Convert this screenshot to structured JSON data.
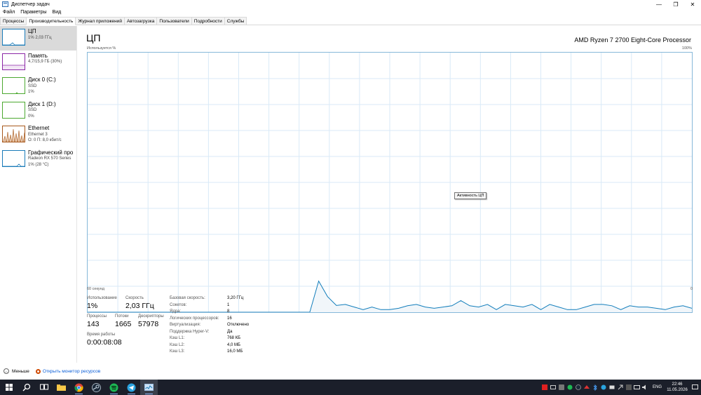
{
  "window": {
    "title": "Диспетчер задач",
    "controls": {
      "minimize": "—",
      "restore": "❐",
      "close": "✕"
    }
  },
  "menu": [
    "Файл",
    "Параметры",
    "Вид"
  ],
  "tabs": [
    {
      "label": "Процессы",
      "active": false
    },
    {
      "label": "Производительность",
      "active": true
    },
    {
      "label": "Журнал приложений",
      "active": false
    },
    {
      "label": "Автозагрузка",
      "active": false
    },
    {
      "label": "Пользователи",
      "active": false
    },
    {
      "label": "Подробности",
      "active": false
    },
    {
      "label": "Службы",
      "active": false
    }
  ],
  "sidebar": {
    "items": [
      {
        "name": "ЦП",
        "line1": "1% 2,03 ГГц",
        "line2": "",
        "color": "#1a7bb9",
        "active": true
      },
      {
        "name": "Память",
        "line1": "4,7/15,9 ГБ (30%)",
        "line2": "",
        "color": "#8b26a6",
        "active": false
      },
      {
        "name": "Диск 0 (C:)",
        "line1": "SSD",
        "line2": "1%",
        "color": "#4ca930",
        "active": false
      },
      {
        "name": "Диск 1 (D:)",
        "line1": "SSD",
        "line2": "0%",
        "color": "#4ca930",
        "active": false
      },
      {
        "name": "Ethernet",
        "line1": "Ethernet 3",
        "line2": "О: 0 П: 8,0 кбит/с",
        "color": "#a7581c",
        "active": false
      },
      {
        "name": "Графический про",
        "line1": "Radeon RX 570 Series",
        "line2": "1% (28 °C)",
        "color": "#1a7bb9",
        "active": false
      }
    ]
  },
  "main": {
    "title": "ЦП",
    "cpu_model": "AMD Ryzen 7 2700 Eight-Core Processor",
    "usage_label": "Используется %",
    "max_label": "100%",
    "axis_left": "60 секунд",
    "axis_right": "0",
    "tooltip": "Активность ЦП",
    "graph_color": "#117dbb",
    "graph_series": [
      0,
      0,
      0,
      0,
      0,
      0,
      0,
      0,
      0,
      0,
      0,
      0,
      0,
      0,
      0,
      0,
      0,
      0,
      0,
      0,
      0,
      0,
      0,
      0,
      0,
      0,
      0,
      0,
      0,
      0,
      0,
      0,
      0,
      0,
      0,
      0,
      0,
      0,
      0,
      0,
      0,
      0,
      0,
      0,
      0,
      0,
      0,
      0,
      0,
      0,
      0,
      0,
      0,
      0,
      0,
      0,
      0,
      0,
      0,
      0,
      0,
      0,
      0,
      0,
      0,
      0,
      0,
      0,
      0,
      0,
      0,
      0,
      0,
      0,
      0,
      0,
      0,
      0,
      0,
      0,
      0,
      0,
      0,
      0,
      0,
      0,
      0,
      0,
      0,
      0,
      0,
      0,
      0,
      0,
      0,
      0,
      0,
      0,
      0,
      0,
      0,
      0,
      0,
      0,
      0,
      0,
      0,
      0,
      0,
      0,
      0,
      0,
      0,
      0,
      0,
      0,
      0,
      0,
      0,
      0,
      0,
      0,
      0,
      0,
      0,
      0,
      0,
      0,
      0,
      0,
      0,
      0,
      0,
      0,
      0,
      0,
      0,
      0,
      0,
      0,
      0,
      0,
      0,
      0,
      0,
      0,
      0,
      0,
      0,
      0,
      0,
      0,
      0,
      0,
      0,
      0,
      0,
      0,
      0,
      0,
      0,
      0,
      0,
      0,
      0,
      0,
      0,
      0,
      0,
      0,
      0,
      0,
      0,
      0,
      0,
      0,
      0,
      0,
      0,
      0,
      0,
      0,
      0,
      0,
      0,
      0,
      0,
      0,
      0,
      0,
      0,
      0,
      0,
      0,
      0,
      0,
      0,
      0,
      0,
      0,
      0,
      0,
      0,
      0,
      0,
      0,
      0,
      0,
      0,
      0,
      0,
      0,
      0,
      0,
      0,
      0,
      0,
      0,
      0,
      0,
      0,
      0,
      0,
      0,
      0,
      0,
      0,
      0,
      0,
      0,
      0,
      0,
      0,
      0,
      0,
      0,
      0,
      0,
      0,
      0,
      0,
      0,
      0,
      0,
      0,
      0,
      0,
      0,
      0,
      0,
      0,
      0,
      0,
      0,
      0,
      0,
      0,
      0,
      0,
      0,
      0,
      0,
      0,
      0,
      0,
      0,
      0,
      0,
      0,
      0,
      0,
      0,
      0,
      0,
      0,
      0,
      0,
      0,
      0,
      0,
      0,
      0,
      0,
      0,
      0,
      0,
      0,
      0,
      0,
      0,
      0,
      0,
      0,
      0,
      0,
      0,
      0,
      0,
      0,
      0,
      0,
      0,
      0,
      0,
      0
    ],
    "cpu_history": [
      0,
      0,
      0,
      0,
      0,
      0,
      0,
      0,
      0,
      0,
      0,
      0,
      0,
      0,
      0,
      0,
      0,
      0,
      0,
      0,
      0,
      0,
      0,
      0,
      0,
      0,
      0,
      0,
      0,
      0,
      0,
      0,
      0,
      0,
      0,
      0,
      0,
      0,
      0,
      0,
      0,
      0,
      0,
      0,
      0,
      0,
      0,
      0,
      0,
      0,
      0,
      0,
      0,
      0,
      0,
      0,
      0,
      0,
      0,
      0,
      0,
      0,
      0,
      0,
      0,
      0,
      0,
      0,
      0,
      0,
      0,
      0,
      0,
      0,
      0,
      0,
      0,
      0,
      0,
      0,
      0,
      0,
      0,
      0,
      0,
      0,
      0,
      0,
      0,
      0,
      0,
      0,
      0,
      0,
      0,
      0,
      0,
      0,
      0,
      0,
      0,
      0,
      0,
      0,
      0,
      0,
      0,
      0,
      0,
      0,
      0,
      0,
      0,
      0,
      0,
      0,
      0,
      0,
      0,
      0,
      0,
      0,
      0,
      0,
      0,
      0,
      0,
      0,
      0,
      0,
      0,
      0,
      0,
      0,
      0,
      0,
      0,
      0,
      0,
      0,
      0,
      0,
      0,
      0,
      0,
      0,
      0,
      0,
      0,
      0,
      0,
      0,
      0,
      0,
      0,
      0,
      0,
      0,
      0,
      0,
      0,
      0,
      0,
      0,
      0,
      0,
      0,
      0,
      0,
      0,
      0,
      0,
      0,
      0,
      0,
      0,
      0,
      0,
      0,
      0,
      0,
      0,
      0,
      0,
      0,
      0,
      0,
      0,
      0,
      0,
      0,
      0,
      0,
      0,
      0,
      0,
      0,
      0,
      0,
      0,
      0,
      0,
      0,
      0,
      0,
      0,
      0,
      0,
      0,
      0,
      0,
      0,
      0,
      0,
      0,
      0,
      0,
      0,
      0,
      0,
      0,
      0,
      0,
      0,
      0,
      0,
      0,
      0,
      0,
      0,
      0,
      0,
      0,
      0,
      0,
      0,
      0,
      0,
      0,
      0,
      0,
      0,
      0,
      0,
      0,
      0,
      0,
      0,
      0,
      0,
      0,
      0,
      0,
      0,
      0,
      0,
      0,
      0,
      0,
      0,
      0,
      0,
      0,
      0,
      0,
      0,
      0,
      0,
      0,
      0,
      0,
      0,
      0,
      0,
      0,
      0,
      0,
      0,
      0,
      0,
      0,
      0,
      0,
      0,
      0,
      0,
      0,
      0,
      0,
      0,
      0,
      0,
      0,
      0,
      0,
      0,
      0,
      0,
      0,
      0,
      0,
      0,
      0,
      0,
      0,
      0
    ],
    "stats": {
      "usage_label": "Использование",
      "usage": "1%",
      "speed_label": "Скорость",
      "speed": "2,03 ГГц",
      "processes_label": "Процессы",
      "processes": "143",
      "threads_label": "Потоки",
      "threads": "1665",
      "handles_label": "Дескрипторы",
      "handles": "57978",
      "uptime_label": "Время работы",
      "uptime": "0:00:08:08"
    },
    "specs": [
      {
        "k": "Базовая скорость:",
        "v": "3,20 ГГц"
      },
      {
        "k": "Сокетов:",
        "v": "1"
      },
      {
        "k": "Ядра:",
        "v": "8"
      },
      {
        "k": "Логических процессоров:",
        "v": "16"
      },
      {
        "k": "Виртуализация:",
        "v": "Отключено"
      },
      {
        "k": "Поддержка Hyper-V:",
        "v": "Да"
      },
      {
        "k": "Кэш L1:",
        "v": "768 КБ"
      },
      {
        "k": "Кэш L2:",
        "v": "4,0 МБ"
      },
      {
        "k": "Кэш L3:",
        "v": "16,0 МБ"
      }
    ]
  },
  "footer": {
    "less": "Меньше",
    "monitor": "Открыть монитор ресурсов"
  },
  "taskbar": {
    "lang": "ENG",
    "time": "22:46",
    "date": "11.05.2026"
  }
}
